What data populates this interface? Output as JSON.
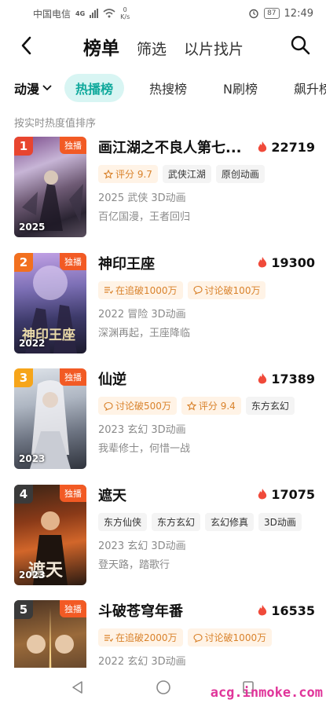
{
  "status": {
    "carrier": "中国电信",
    "net": "4G",
    "speed": "0",
    "speed_unit": "K/s",
    "battery": "87",
    "time": "12:49"
  },
  "nav": {
    "tabs": [
      "榜单",
      "筛选",
      "以片找片"
    ]
  },
  "catbar": {
    "category": "动漫",
    "chips": [
      "热播榜",
      "热搜榜",
      "N刷榜",
      "飙升榜"
    ]
  },
  "sort_note": "按实时热度值排序",
  "colors": {
    "accent": "#10a99c",
    "rank1": "#e8452f",
    "rank2": "#f2701f",
    "rank3": "#f6a51a",
    "rank_other": "#3a3a3a",
    "heat": "#f04a3a"
  },
  "items": [
    {
      "rank": "1",
      "badge": "独播",
      "title": "画江湖之不良人第七...",
      "heat": "22719",
      "poster_year": "2025",
      "tags": [
        {
          "icon": "star",
          "text": "评分 9.7",
          "style": "orange"
        },
        {
          "text": "武侠江湖"
        },
        {
          "text": "原创动画"
        }
      ],
      "meta": "2025 武侠 3D动画",
      "desc": "百亿国漫，王者回归"
    },
    {
      "rank": "2",
      "badge": "独播",
      "title": "神印王座",
      "heat": "19300",
      "poster_year": "2022",
      "tags": [
        {
          "icon": "list",
          "text": "在追破1000万",
          "style": "orange"
        },
        {
          "icon": "chat",
          "text": "讨论破100万",
          "style": "orange"
        }
      ],
      "meta": "2022 冒险 3D动画",
      "desc": "深渊再起，王座降临"
    },
    {
      "rank": "3",
      "badge": "独播",
      "title": "仙逆",
      "heat": "17389",
      "poster_year": "2023",
      "tags": [
        {
          "icon": "chat",
          "text": "讨论破500万",
          "style": "orange"
        },
        {
          "icon": "star",
          "text": "评分 9.4",
          "style": "orange"
        },
        {
          "text": "东方玄幻"
        }
      ],
      "meta": "2023 玄幻 3D动画",
      "desc": "我辈修士，何惜一战"
    },
    {
      "rank": "4",
      "badge": "独播",
      "title": "遮天",
      "heat": "17075",
      "poster_year": "2023",
      "tags": [
        {
          "text": "东方仙侠"
        },
        {
          "text": "东方玄幻"
        },
        {
          "text": "玄幻修真"
        },
        {
          "text": "3D动画"
        }
      ],
      "meta": "2023 玄幻 3D动画",
      "desc": "登天路，踏歌行"
    },
    {
      "rank": "5",
      "badge": "独播",
      "title": "斗破苍穹年番",
      "heat": "16535",
      "poster_year": "",
      "tags": [
        {
          "icon": "list",
          "text": "在追破2000万",
          "style": "orange"
        },
        {
          "icon": "chat",
          "text": "讨论破1000万",
          "style": "orange"
        }
      ],
      "meta": "2022 玄幻 3D动画",
      "desc": ""
    }
  ],
  "watermark": "acg.inmoke.com"
}
